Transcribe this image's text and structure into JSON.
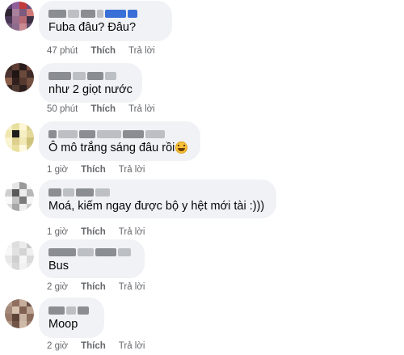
{
  "comments": [
    {
      "text": "Fuba đâu? Đâu?",
      "time": "47 phút",
      "like": "Thích",
      "reply": "Trả lời",
      "has_emoji": false,
      "avatar_colors": [
        "#5a3f6a",
        "#8e5d9a",
        "#c23b3b",
        "#6b4f7a",
        "#2e2433",
        "#a8809c",
        "#7b5a7d",
        "#d07a78",
        "#4a3856",
        "#9a6f8e",
        "#b56a74",
        "#3d2f45",
        "#6e5577",
        "#8d6b8c",
        "#c98a92",
        "#5f4a66"
      ]
    },
    {
      "text": "như 2 giọt nước",
      "time": "50 phút",
      "like": "Thích",
      "reply": "Trả lời",
      "has_emoji": false,
      "avatar_colors": [
        "#3a2a26",
        "#5c3c33",
        "#2a1d1b",
        "#7a4e3f",
        "#4d3430",
        "#1f1514",
        "#6a4a3c",
        "#3e2b27",
        "#8a5f4a",
        "#2f201d",
        "#56392f",
        "#73503f",
        "#3a2723",
        "#4f3a31",
        "#2c1e1c",
        "#684739"
      ]
    },
    {
      "text": "Ô mô trắng sáng đâu rồi",
      "time": "1 giờ",
      "like": "Thích",
      "reply": "Trả lời",
      "has_emoji": true,
      "avatar_colors": [
        "#f5f0c8",
        "#e8e0a0",
        "#fff6d6",
        "#d8cf8a",
        "#f0e6b0",
        "#1e1e1e",
        "#f6efc4",
        "#e4d99a",
        "#fbf4d2",
        "#ddd08c",
        "#f2e8b6",
        "#cfc27a",
        "#f7f1cc",
        "#e9df9e",
        "#fffae0",
        "#d6ca86"
      ]
    },
    {
      "text": "Moá, kiếm ngay được bộ y hệt mới tài :)))",
      "time": "1 giờ",
      "like": "Thích",
      "reply": "Trả lời",
      "has_emoji": false,
      "avatar_colors": [
        "#ffffff",
        "#e6e6e6",
        "#9a9a9a",
        "#f2f2f2",
        "#d0d0d0",
        "#5a5a5a",
        "#ededed",
        "#b8b8b8",
        "#fafafa",
        "#c4c4c4",
        "#7a7a7a",
        "#f6f6f6",
        "#dcdcdc",
        "#a6a6a6",
        "#eeeeee",
        "#cccccc"
      ]
    },
    {
      "text": "Bus",
      "time": "2 giờ",
      "like": "Thích",
      "reply": "Trả lời",
      "has_emoji": false,
      "avatar_colors": [
        "#f4f4f4",
        "#dedede",
        "#ececec",
        "#c9c9c9",
        "#f8f8f8",
        "#e2e2e2",
        "#d4d4d4",
        "#f0f0f0",
        "#e8e8e8",
        "#cfcfcf",
        "#f6f6f6",
        "#dadada",
        "#eeeeee",
        "#d8d8d8",
        "#f2f2f2",
        "#e4e4e4"
      ]
    },
    {
      "text": "Moop",
      "time": "2 giờ",
      "like": "Thích",
      "reply": "Trả lời",
      "has_emoji": false,
      "avatar_colors": [
        "#b39a8a",
        "#8e6f60",
        "#c7ae9c",
        "#6e5044",
        "#a4897a",
        "#d6c0ae",
        "#7f6052",
        "#bda392",
        "#98796a",
        "#5e4438",
        "#c9b3a3",
        "#8a6b5c",
        "#ad9382",
        "#735548",
        "#d0baa8",
        "#9c7e6f"
      ]
    }
  ],
  "colors": {
    "bubble": "#f0f2f5",
    "meta": "#65676b",
    "text": "#050505"
  }
}
